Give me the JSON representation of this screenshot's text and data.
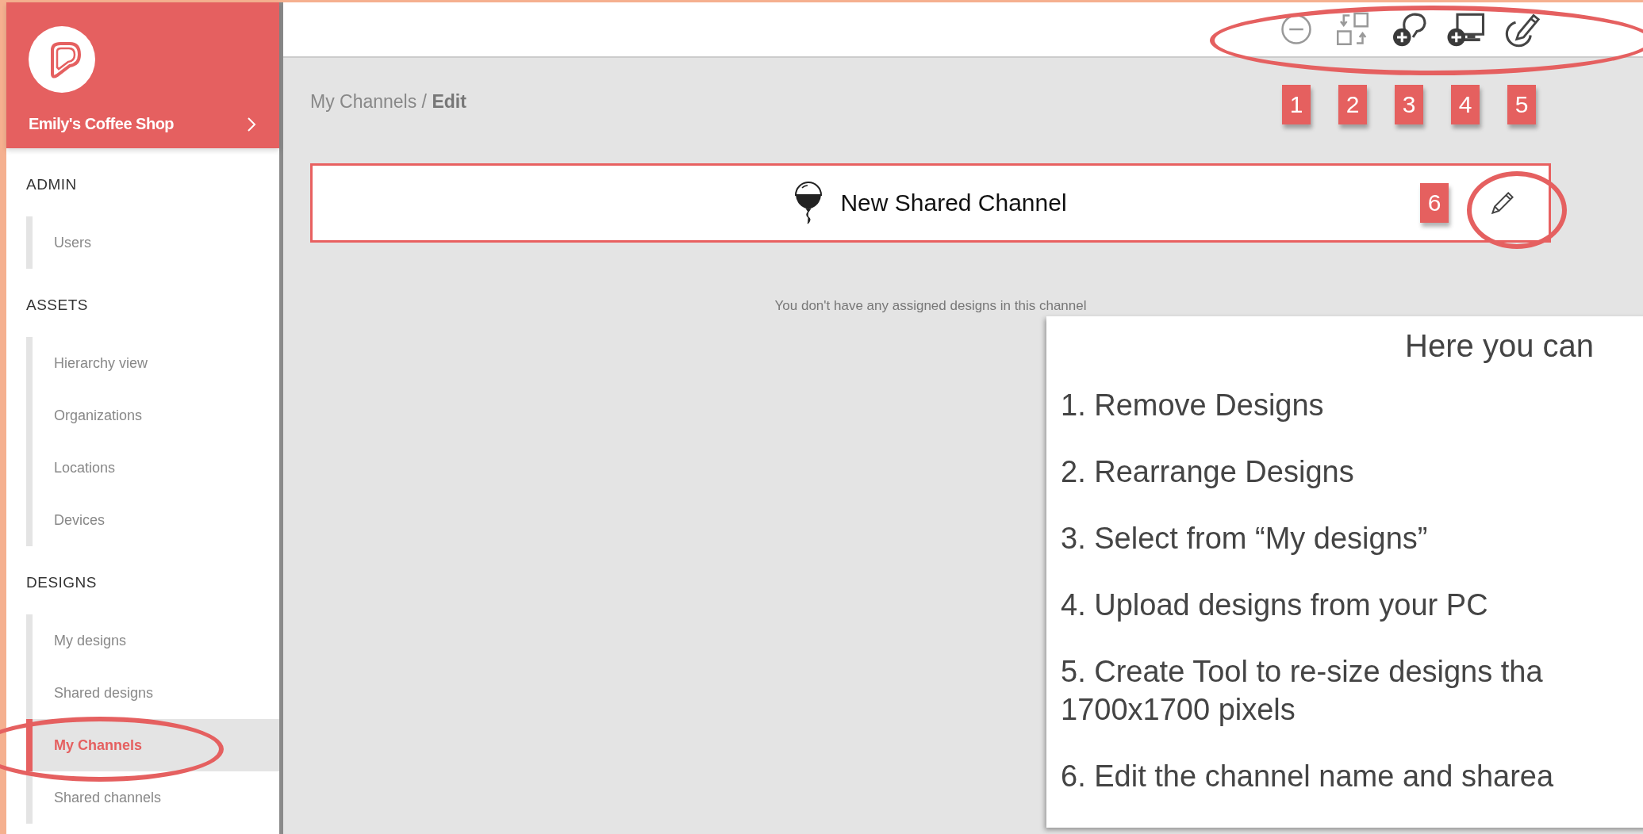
{
  "sidebar": {
    "brand": "Emily's Coffee Shop",
    "sections": [
      {
        "heading": "ADMIN",
        "items": [
          {
            "label": "Users",
            "selected": false
          }
        ]
      },
      {
        "heading": "ASSETS",
        "items": [
          {
            "label": "Hierarchy view",
            "selected": false
          },
          {
            "label": "Organizations",
            "selected": false
          },
          {
            "label": "Locations",
            "selected": false
          },
          {
            "label": "Devices",
            "selected": false
          }
        ]
      },
      {
        "heading": "DESIGNS",
        "items": [
          {
            "label": "My designs",
            "selected": false
          },
          {
            "label": "Shared designs",
            "selected": false
          },
          {
            "label": "My Channels",
            "selected": true
          },
          {
            "label": "Shared channels",
            "selected": false
          }
        ]
      }
    ]
  },
  "breadcrumb": "My Channels / **Edit**",
  "channel": {
    "name": "New Shared Channel"
  },
  "empty_message": "You don't have any assigned designs in this channel",
  "annotations": {
    "toolbar_badges": [
      "1",
      "2",
      "3",
      "4",
      "5"
    ],
    "edit_badge": "6",
    "help": {
      "title": "Here you can",
      "items": [
        "1. Remove Designs",
        "2. Rearrange Designs",
        "3. Select from “My designs”",
        "4. Upload designs from your PC",
        "5. Create Tool to re-size designs tha 1700x1700 pixels",
        "6. Edit the channel name and sharea"
      ]
    }
  }
}
